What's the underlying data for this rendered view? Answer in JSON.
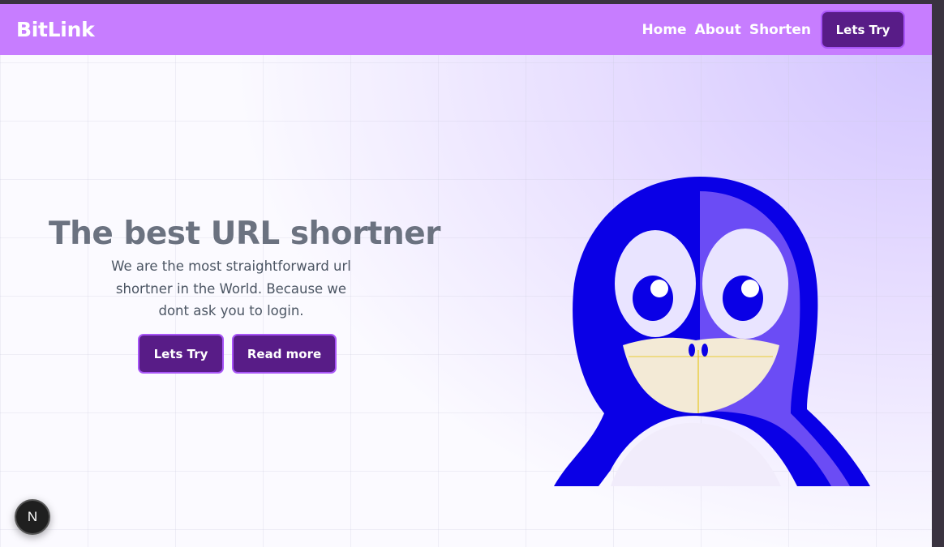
{
  "nav": {
    "brand": "BitLink",
    "links": [
      "Home",
      "About",
      "Shorten"
    ],
    "cta_label": "Lets Try"
  },
  "hero": {
    "title": "The best URL shortner",
    "subtitle": "We are the most straightforward url shortner in the World. Because we dont ask you to login.",
    "primary_button": "Lets Try",
    "secondary_button": "Read more"
  },
  "dev_badge": {
    "label": "N"
  },
  "colors": {
    "navbar": "#c77dff",
    "button": "#581c87",
    "button_border": "#a855f7",
    "title": "#6b7280",
    "penguin_blue": "#0a00e6",
    "penguin_shade": "#6b4cf5"
  },
  "illustration": "penguin-mascot"
}
